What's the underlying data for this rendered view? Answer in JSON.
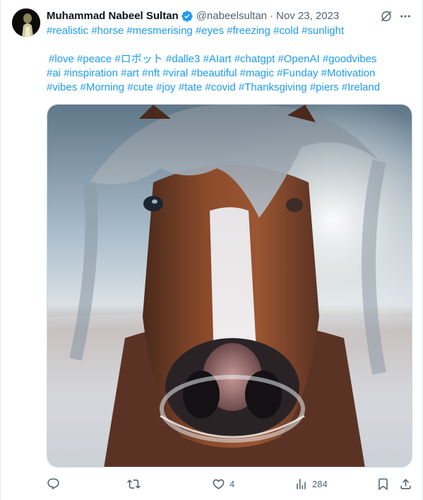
{
  "author": {
    "display_name": "Muhammad Nabeel Sultan",
    "handle": "@nabeelsultan",
    "separator": "·",
    "date": "Nov 23, 2023",
    "verified": true
  },
  "tweet": {
    "line1_tags": [
      "#realistic",
      "#horse",
      "#mesmerising",
      "#eyes",
      "#freezing",
      "#cold",
      "#sunlight"
    ],
    "line2_tags": [
      "#love",
      "#peace",
      "#ロボット",
      "#dalle3",
      "#AIart",
      "#chatgpt",
      "#OpenAI",
      "#goodvibes"
    ],
    "line3_tags": [
      "#ai",
      "#inspiration",
      "#art",
      "#nft",
      "#viral",
      "#beautiful",
      "#magic",
      "#Funday",
      "#Motivation"
    ],
    "line4_tags": [
      "#vibes",
      "#Morning",
      "#cute",
      "#joy",
      "#tate",
      "#covid",
      "#Thanksgiving",
      "#piers",
      "#Ireland"
    ]
  },
  "actions": {
    "reply_count": "",
    "retweet_count": "",
    "like_count": "4",
    "views_count": "284"
  },
  "icons": {
    "verified": "verified-badge-icon",
    "grok": "grok-icon",
    "more": "more-icon",
    "reply": "reply-icon",
    "retweet": "retweet-icon",
    "like": "heart-icon",
    "views": "views-icon",
    "bookmark": "bookmark-icon",
    "share": "share-icon"
  },
  "colors": {
    "link": "#1d9bf0",
    "muted": "#536471",
    "text": "#0f1419",
    "verified": "#1d9bf0"
  }
}
